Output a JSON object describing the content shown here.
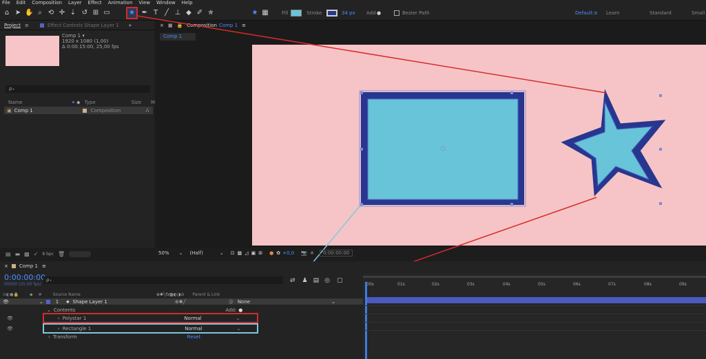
{
  "menu": [
    "File",
    "Edit",
    "Composition",
    "Layer",
    "Effect",
    "Animation",
    "View",
    "Window",
    "Help"
  ],
  "toolbar": {
    "fill_label": "Fill",
    "stroke_label": "Stroke",
    "stroke_width": "34 px",
    "add_label": "Add",
    "bezier_label": "Bezier Path",
    "workspaces": [
      "Default",
      "Learn",
      "Standard",
      "Small"
    ]
  },
  "project": {
    "tab": "Project",
    "effect_controls": "Effect Controls Shape Layer 1",
    "comp_name": "Comp 1 ▾",
    "comp_res": "1920 x 1080 (1,00)",
    "comp_dur": "Δ 0:00:15:00, 25,00 fps",
    "search": "ρ₊",
    "col_name": "Name",
    "col_type": "Type",
    "col_size": "Size",
    "col_m": "M",
    "item_name": "Comp 1",
    "item_type": "Composition",
    "bpc": "8 bpc"
  },
  "viewer": {
    "tab_label": "Composition",
    "tab_comp": "Comp 1",
    "sub_tab": "Comp 1",
    "zoom": "50%",
    "resolution": "(Half)",
    "timecode": "0:00:00:00",
    "exposure": "+0,0"
  },
  "timeline": {
    "tab": "Comp 1",
    "timecode": "0:00:00:00",
    "frame": "00000 (25.00 fps)",
    "search": "ρ₊",
    "col_source": "Source Name",
    "col_parent": "Parent & Link",
    "layer_num": "1",
    "layer_name": "Shape Layer 1",
    "parent": "None",
    "contents": "Contents",
    "add": "Add:",
    "polystar": "Polystar 1",
    "rectangle": "Rectangle 1",
    "blend1": "Normal",
    "blend2": "Normal",
    "transform": "Transform",
    "reset": "Reset",
    "ticks": [
      "00s",
      "01s",
      "02s",
      "03s",
      "04s",
      "05s",
      "06s",
      "07s",
      "08s",
      "09s"
    ]
  },
  "colors": {
    "accent_red": "#d82b2b",
    "accent_blue": "#7cc9e2",
    "comp_bg": "#f6c4c6",
    "shape_fill": "#67c4d9",
    "shape_stroke": "#27378f"
  }
}
